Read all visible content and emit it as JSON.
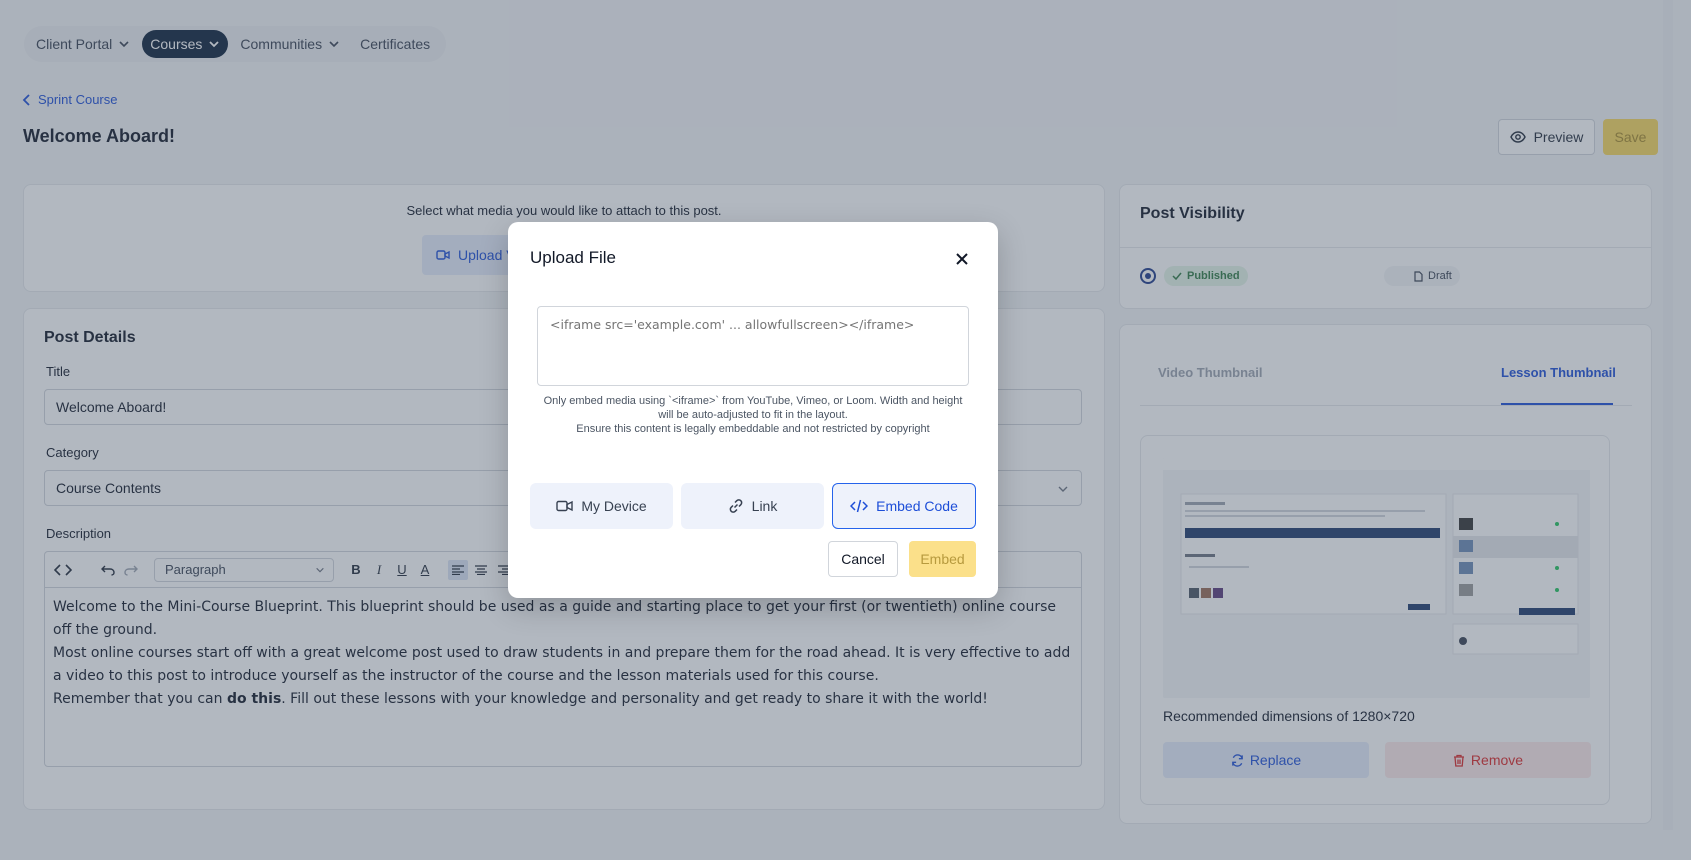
{
  "nav": {
    "items": [
      {
        "label": "Client Portal",
        "has_chevron": true,
        "active": false
      },
      {
        "label": "Courses",
        "has_chevron": true,
        "active": true
      },
      {
        "label": "Communities",
        "has_chevron": true,
        "active": false
      },
      {
        "label": "Certificates",
        "has_chevron": false,
        "active": false
      }
    ]
  },
  "breadcrumb": {
    "back_label": "Sprint Course"
  },
  "page": {
    "title": "Welcome Aboard!"
  },
  "header_actions": {
    "preview_label": "Preview",
    "save_label": "Save"
  },
  "media": {
    "prompt": "Select what media you would like to attach to this post.",
    "upload_label": "Upload V"
  },
  "post_details": {
    "heading": "Post Details",
    "title_label": "Title",
    "title_value": "Welcome Aboard!",
    "category_label": "Category",
    "category_value": "Course Contents",
    "description_label": "Description",
    "paragraph_select": "Paragraph",
    "description": {
      "line1": "Welcome to the Mini-Course Blueprint. This blueprint should be used as a guide and starting place to get your first (or twentieth) online course off the ground.",
      "line2": "Most online courses start off with a great welcome post used to draw students in and prepare them for the road ahead. It is very effective to add a video to this post to introduce yourself as the instructor of the course and the lesson materials used for this course.",
      "line3_pre": "Remember that you can ",
      "line3_bold": "do this",
      "line3_post": ". Fill out these lessons with your knowledge and personality and get ready to share it with the world!"
    }
  },
  "visibility": {
    "heading": "Post Visibility",
    "published_label": "Published",
    "draft_label": "Draft",
    "selected": "Published"
  },
  "thumbnail": {
    "tab_video": "Video Thumbnail",
    "tab_lesson": "Lesson Thumbnail",
    "active_tab": "Lesson Thumbnail",
    "recommended": "Recommended dimensions of 1280×720",
    "replace_label": "Replace",
    "remove_label": "Remove"
  },
  "modal": {
    "title": "Upload File",
    "textarea_placeholder": "<iframe src='example.com' ... allowfullscreen></iframe>",
    "help_line1": "Only embed media using `<iframe>` from YouTube, Vimeo, or Loom. Width and height will be auto-adjusted to fit in the layout.",
    "help_line2": "Ensure this content is legally embeddable and not restricted by copyright",
    "source_buttons": {
      "device": "My Device",
      "link": "Link",
      "embed": "Embed Code",
      "selected": "Embed Code"
    },
    "cancel_label": "Cancel",
    "embed_label": "Embed"
  },
  "colors": {
    "accent": "#1d4ed8",
    "nav_active": "#0b1f3a",
    "save_disabled": "#f9d75c",
    "published_green": "#2f7b44",
    "danger": "#dc2626"
  },
  "icons": {
    "back": "chevron-left-icon",
    "preview": "eye-icon",
    "upload": "video-camera-icon",
    "close": "close-icon",
    "device": "video-camera-icon",
    "link": "link-icon",
    "embed": "code-icon",
    "replace": "refresh-icon",
    "remove": "trash-icon"
  }
}
